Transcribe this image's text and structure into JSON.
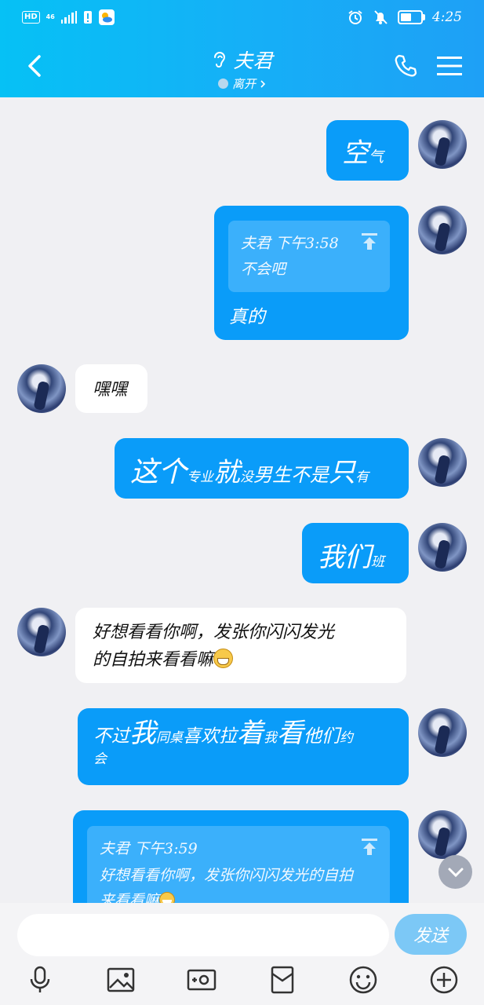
{
  "status_bar": {
    "hd": "HD",
    "network": "46",
    "time": "4:25",
    "battery_level": 0.55
  },
  "header": {
    "title": "夫君",
    "status": "离开",
    "icons": [
      "back-icon",
      "ear-icon",
      "clock-icon",
      "phone-icon",
      "menu-icon"
    ]
  },
  "messages": [
    {
      "id": "m1",
      "side": "out",
      "segments": [
        {
          "text": "空",
          "size": 34
        },
        {
          "text": "气",
          "size": 19
        }
      ]
    },
    {
      "id": "m2",
      "side": "out",
      "quote": {
        "sender": "夫君 下午3:58",
        "text": "不会吧"
      },
      "text": "真的"
    },
    {
      "id": "m3",
      "side": "in",
      "text": "嘿嘿"
    },
    {
      "id": "m4",
      "side": "out",
      "segments": [
        {
          "text": "这个",
          "size": 36
        },
        {
          "text": "专业",
          "size": 17
        },
        {
          "text": "就",
          "size": 34
        },
        {
          "text": "没",
          "size": 17
        },
        {
          "text": "男生不是",
          "size": 24
        },
        {
          "text": "只",
          "size": 34
        },
        {
          "text": "有",
          "size": 17
        }
      ]
    },
    {
      "id": "m5",
      "side": "out",
      "segments": [
        {
          "text": "我们",
          "size": 34
        },
        {
          "text": "班",
          "size": 17
        }
      ]
    },
    {
      "id": "m6",
      "side": "in",
      "line1": "好想看看你啊，发张你闪闪发光",
      "line2": "的自拍来看看嘛"
    },
    {
      "id": "m7",
      "side": "out",
      "segments": [
        {
          "text": "不过",
          "size": 23
        },
        {
          "text": "我",
          "size": 34
        },
        {
          "text": "同桌",
          "size": 17
        },
        {
          "text": "喜欢拉",
          "size": 23
        },
        {
          "text": "着",
          "size": 34
        },
        {
          "text": "我",
          "size": 17
        },
        {
          "text": "看",
          "size": 34
        },
        {
          "text": "他们",
          "size": 23
        },
        {
          "text": "约",
          "size": 17
        }
      ],
      "line2": "会"
    },
    {
      "id": "m8",
      "side": "out",
      "quote": {
        "sender": "夫君 下午3:59",
        "text": "好想看看你啊，发张你闪闪发光的自拍",
        "text2": "来看看嘛"
      }
    }
  ],
  "composer": {
    "input_value": "",
    "send_label": "发送",
    "tools": [
      "microphone-icon",
      "image-icon",
      "camera-icon",
      "red-packet-icon",
      "emoji-icon",
      "plus-icon"
    ]
  },
  "colors": {
    "header_start": "#06c1f5",
    "header_end": "#1ea0f6",
    "outgoing_bubble": "#0a9cf9",
    "incoming_bubble": "#ffffff",
    "background": "#f0f0f3",
    "send_button": "#7cc8f6"
  }
}
